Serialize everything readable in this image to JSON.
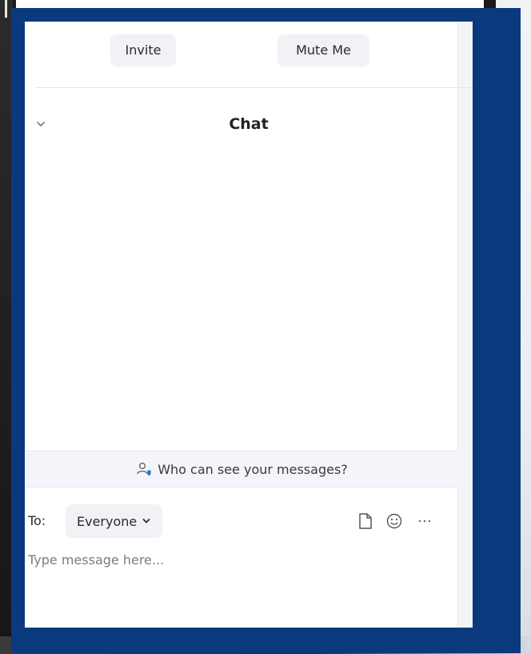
{
  "toolbar": {
    "invite_label": "Invite",
    "mute_label": "Mute Me"
  },
  "chat": {
    "title": "Chat",
    "visibility_notice": "Who can see your messages?",
    "to_label": "To:",
    "recipient": "Everyone",
    "message_placeholder": "Type message here..."
  },
  "icons": {
    "collapse": "chevron-down-icon",
    "visibility": "people-icon",
    "recipient_dropdown": "chevron-down-icon",
    "file": "file-icon",
    "emoji": "emoji-icon",
    "more": "more-icon"
  },
  "colors": {
    "frame_blue": "#0a3a7d",
    "button_bg": "#f1f2f5",
    "notice_bg": "#f3f5fb",
    "accent_blue": "#1f6fd1"
  }
}
